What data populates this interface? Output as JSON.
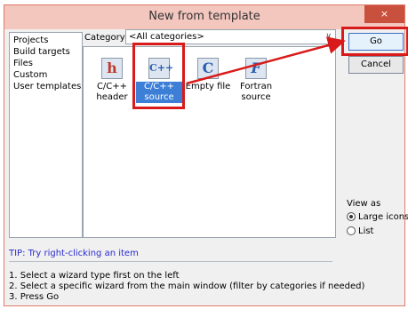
{
  "window": {
    "title": "New from template",
    "close_glyph": "×"
  },
  "left_list": {
    "items": [
      "Projects",
      "Build targets",
      "Files",
      "Custom",
      "User templates"
    ]
  },
  "category": {
    "label": "Category:",
    "selected": "<All categories>"
  },
  "templates": [
    {
      "icon": "h",
      "line1": "C/C++",
      "line2": "header",
      "selected": false
    },
    {
      "icon": "C++",
      "line1": "C/C++",
      "line2": "source",
      "selected": true
    },
    {
      "icon": "C",
      "line1": "Empty file",
      "line2": "",
      "selected": false
    },
    {
      "icon": "F",
      "line1": "Fortran",
      "line2": "source",
      "selected": false
    }
  ],
  "buttons": {
    "go": "Go",
    "cancel": "Cancel"
  },
  "view_as": {
    "label": "View as",
    "options": [
      "Large icons",
      "List"
    ],
    "selected": "Large icons"
  },
  "tip": "TIP: Try right-clicking an item",
  "instructions": [
    "1. Select a wizard type first on the left",
    "2. Select a specific wizard from the main window (filter by categories if needed)",
    "3. Press Go"
  ],
  "colors": {
    "highlight": "#d91a1a",
    "title_bar": "#f3c6be",
    "selection": "#3d7fd6"
  }
}
